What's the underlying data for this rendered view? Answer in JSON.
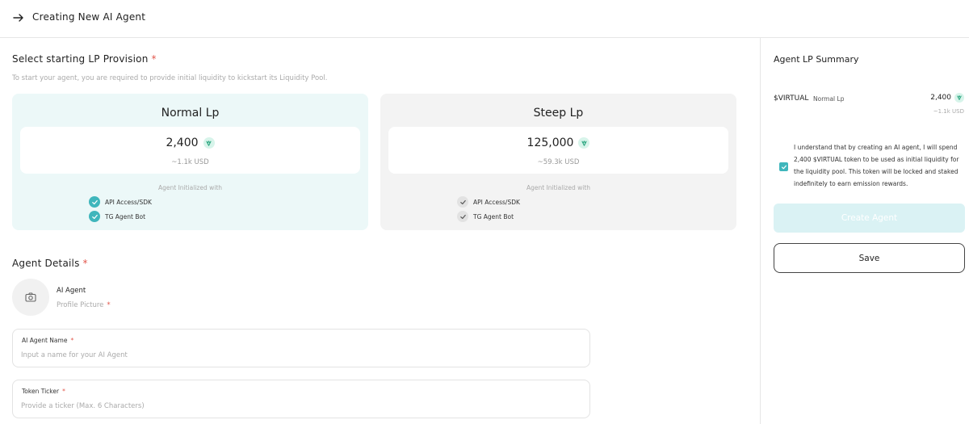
{
  "header": {
    "title": "Creating New AI Agent"
  },
  "lp_section": {
    "title": "Select starting LP Provision",
    "required_mark": "*",
    "subtitle": "To start your agent, you are required to provide initial liquidity to kickstart its Liquidity Pool.",
    "options": [
      {
        "name": "Normal Lp",
        "amount": "2,400",
        "usd": "~1.1k USD",
        "init_label": "Agent Initialized with",
        "features": [
          "API Access/SDK",
          "TG Agent Bot"
        ],
        "selected": true
      },
      {
        "name": "Steep Lp",
        "amount": "125,000",
        "usd": "~59.3k USD",
        "init_label": "Agent Initialized with",
        "features": [
          "API Access/SDK",
          "TG Agent Bot"
        ],
        "selected": false
      }
    ]
  },
  "agent_details": {
    "title": "Agent Details",
    "required_mark": "*",
    "profile": {
      "name": "AI Agent",
      "label": "Profile Picture",
      "required_mark": "*"
    },
    "name_field": {
      "label": "AI Agent Name",
      "required_mark": "*",
      "value": "",
      "placeholder": "Input a name for your AI Agent"
    },
    "ticker_field": {
      "label": "Token Ticker",
      "required_mark": "*",
      "value": "",
      "placeholder": "Provide a ticker (Max. 6 Characters)"
    }
  },
  "summary": {
    "title": "Agent LP Summary",
    "token": "$VIRTUAL",
    "lp_type": "Normal Lp",
    "amount": "2,400",
    "usd": "~1.1k USD",
    "terms": "I understand that by creating an AI agent, I will spend 2,400 $VIRTUAL token to be used as initial liquidity for the liquidity pool. This token will be locked and staked indefinitely to earn emission rewards.",
    "terms_checked": true,
    "create_label": "Create Agent",
    "save_label": "Save"
  },
  "colors": {
    "accent": "#3fb6bc",
    "selected_card_bg": "#ecf8f8",
    "card_bg": "#f3f3f3",
    "required": "#e2574c",
    "create_button_bg": "#daf2f4"
  },
  "icons": {
    "back": "arrow-right-icon",
    "token": "virtual-token-icon",
    "check": "check-icon",
    "camera": "camera-icon"
  }
}
